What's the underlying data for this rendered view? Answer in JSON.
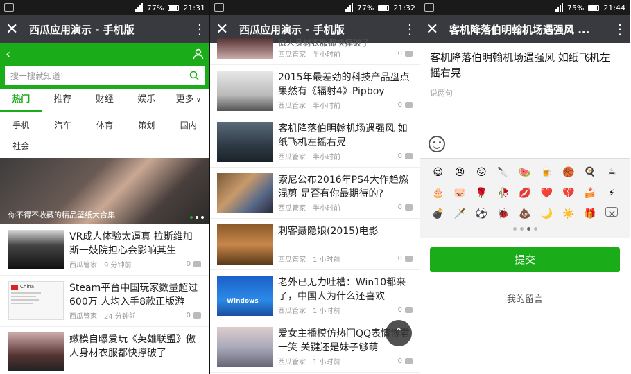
{
  "colors": {
    "accent": "#1aad19",
    "titlebar": "#393a3f",
    "status": "#1a1a1a"
  },
  "screen1": {
    "status": {
      "battery": "77%",
      "time": "21:31"
    },
    "title": "西瓜应用演示 - 手机版",
    "search_placeholder": "搜一搜就知道!",
    "tabs": [
      "热门",
      "推荐",
      "财经",
      "娱乐",
      "更多"
    ],
    "categories": [
      "手机",
      "汽车",
      "体育",
      "策划",
      "国内",
      "社会"
    ],
    "banner_caption": "你不得不收藏的精品壁纸大合集",
    "news": [
      {
        "title": "VR成人体验太逼真 拉斯维加斯一妓院担心会影响其生",
        "source": "西瓜管家",
        "time": "9 分钟前",
        "count": "0"
      },
      {
        "title": "Steam平台中国玩家数量超过600万 人均入手8款正版游",
        "source": "西瓜管家",
        "time": "24 分钟前",
        "count": "0"
      },
      {
        "title": "嫩模自曝爱玩《英雄联盟》傲人身材衣服都快撑破了",
        "source": "",
        "time": "",
        "count": ""
      }
    ],
    "steam_thumb_label": "China"
  },
  "screen2": {
    "status": {
      "battery": "77%",
      "time": "21:32"
    },
    "title": "西瓜应用演示 - 手机版",
    "partial_top": {
      "title": "傲人身材衣服都快撑破了",
      "source": "西瓜管家",
      "time": "半小时前",
      "count": "0"
    },
    "news": [
      {
        "title": "2015年最差劲的科技产品盘点 果然有《辐射4》Pipboy",
        "source": "西瓜管家",
        "time": "半小时前",
        "count": "0"
      },
      {
        "title": "客机降落伯明翰机场遇强风 如纸飞机左摇右晃",
        "source": "西瓜管家",
        "time": "半小时前",
        "count": "0"
      },
      {
        "title": "索尼公布2016年PS4大作趋燃混剪 是否有你最期待的?",
        "source": "西瓜管家",
        "time": "半小时前",
        "count": "0"
      },
      {
        "title": "刺客聂隐娘(2015)电影",
        "source": "西瓜管家",
        "time": "1 小时前",
        "count": "0"
      },
      {
        "title": "老外已无力吐槽：Win10都来了，中国人为什么还喜欢",
        "source": "西瓜管家",
        "time": "1 小时前",
        "count": "0"
      },
      {
        "title": "爱女主播模仿热门QQ表情博君一笑 关键还是妹子够萌",
        "source": "西瓜管家",
        "time": "1 小时前",
        "count": "0"
      }
    ],
    "windows_label": "Windows",
    "fab_icon": "scroll-top-icon"
  },
  "screen3": {
    "status": {
      "battery": "75%",
      "time": "21:44"
    },
    "title": "客机降落伯明翰机场遇强风 ...",
    "article_title": "客机降落伯明翰机场遇强风 如纸飞机左摇右晃",
    "comment_placeholder": "说两句",
    "emojis": [
      "😉",
      "😠",
      "😖",
      "🔪",
      "🍉",
      "🍺",
      "🏀",
      "🍳",
      "☕",
      "🎂",
      "🐷",
      "🌹",
      "🥀",
      "💋",
      "❤️",
      "💔",
      "🍰",
      "⚡",
      "💣",
      "🗡️",
      "⚽",
      "🐞",
      "💩",
      "🌙",
      "☀️",
      "🎁",
      ""
    ],
    "delete_key": "✕",
    "submit_label": "提交",
    "my_comments_label": "我的留言"
  }
}
